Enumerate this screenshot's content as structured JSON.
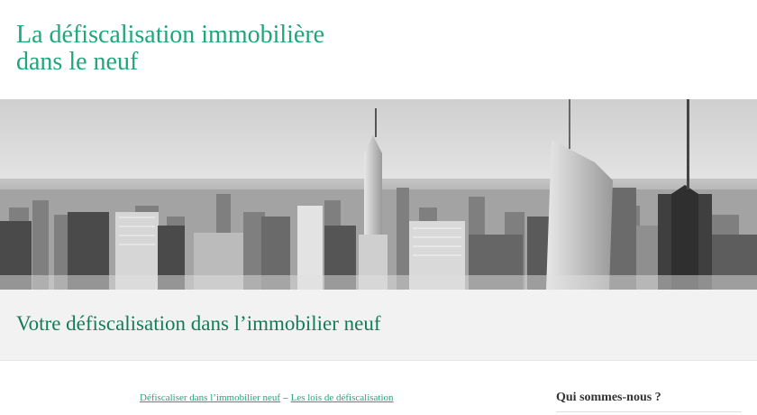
{
  "header": {
    "title_line1": "La défiscalisation immobilière",
    "title_line2": "dans le neuf"
  },
  "hero": {
    "image": "city-skyline-photo",
    "tone": "grayscale"
  },
  "tagline": "Votre défiscalisation dans l’immobilier neuf",
  "breadcrumb": {
    "link1": "Défiscaliser dans l’immobilier neuf",
    "separator": "–",
    "link2": "Les lois de défiscalisation"
  },
  "sidebar": {
    "widget_title": "Qui sommes-nous ?"
  },
  "colors": {
    "accent": "#1fa67a",
    "tagline": "#177a5a",
    "band": "#f2f2f2"
  }
}
